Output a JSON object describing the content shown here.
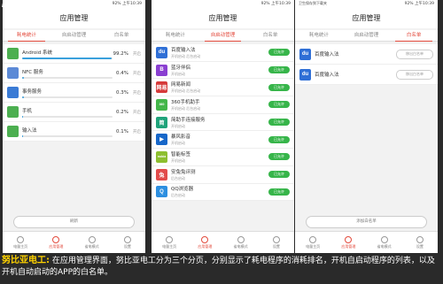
{
  "watermark": "IT之HOME",
  "status_bar": {
    "battery": "92%",
    "time": "上午10:39",
    "left_p3": "卫生保存到下载夹"
  },
  "header_title": "应用管理",
  "tabs": [
    "耗电统计",
    "自启动管理",
    "白名单"
  ],
  "screen1": {
    "active_tab": 0,
    "items": [
      {
        "name": "Android 系统",
        "percent": "99.2%",
        "fill": 0.99,
        "action": "开启",
        "icon": "android-system-icon",
        "color": "#4caf50"
      },
      {
        "name": "NFC 服务",
        "percent": "0.4%",
        "fill": 0.02,
        "action": "开启",
        "icon": "nfc-icon",
        "color": "#5c8ad6"
      },
      {
        "name": "事务服务",
        "percent": "0.3%",
        "fill": 0.015,
        "action": "开启",
        "icon": "service-icon",
        "color": "#3a7bd5"
      },
      {
        "name": "手机",
        "percent": "0.2%",
        "fill": 0.01,
        "action": "开启",
        "icon": "phone-icon",
        "color": "#4caf50"
      },
      {
        "name": "输入法",
        "percent": "0.1%",
        "fill": 0.005,
        "action": "开启",
        "icon": "keyboard-icon",
        "color": "#4caf50"
      }
    ],
    "bottom_button": "刷新"
  },
  "screen2": {
    "active_tab": 1,
    "items": [
      {
        "name": "百度输入法",
        "sub": "开机启动 后台启动",
        "button": "已允许",
        "icon": "baidu-input-icon",
        "color": "#2f6fd6",
        "glyph": "du"
      },
      {
        "name": "蓝牙伴侣",
        "sub": "开机启动",
        "button": "已允许",
        "icon": "bluetooth-icon",
        "color": "#8a3fd1",
        "glyph": "B"
      },
      {
        "name": "网易新闻",
        "sub": "开机启动 后台启动",
        "button": "已允许",
        "icon": "netease-icon",
        "color": "#d63a3a",
        "glyph": "网易"
      },
      {
        "name": "360手机助手",
        "sub": "开机启动 后台启动",
        "button": "已允许",
        "icon": "360-icon",
        "color": "#43b649",
        "glyph": "360"
      },
      {
        "name": "简助手连接服务",
        "sub": "开机启动",
        "button": "已允许",
        "icon": "jian-icon",
        "color": "#1fa37a",
        "glyph": "简"
      },
      {
        "name": "暴风影音",
        "sub": "开机启动",
        "button": "已允许",
        "icon": "storm-icon",
        "color": "#1767c9",
        "glyph": "▶"
      },
      {
        "name": "智能标签",
        "sub": "开机启动",
        "button": "已允许",
        "icon": "smart-tag-icon",
        "color": "#8dbf2f",
        "glyph": "nubia"
      },
      {
        "name": "安兔兔评测",
        "sub": "后台启动",
        "button": "已允许",
        "icon": "antutu-icon",
        "color": "#e24b4b",
        "glyph": "兔"
      },
      {
        "name": "QQ浏览器",
        "sub": "后台启动",
        "button": "已允许",
        "icon": "qq-browser-icon",
        "color": "#2d8fe0",
        "glyph": "Q"
      }
    ]
  },
  "screen3": {
    "active_tab": 2,
    "items": [
      {
        "name": "百度输入法",
        "button": "移出白名单",
        "icon": "baidu-input-icon",
        "color": "#2f6fd6",
        "glyph": "du"
      },
      {
        "name": "百度输入法",
        "button": "移出白名单",
        "icon": "baidu-input-icon",
        "color": "#2f6fd6",
        "glyph": "du"
      }
    ],
    "bottom_button": "添加白名单"
  },
  "bottom_nav": [
    "电量主页",
    "应用管理",
    "省电模式",
    "设置"
  ],
  "caption": {
    "highlight": "努比亚电工:",
    "text": "在应用管理界面，努比亚电工分为三个分页，分别显示了耗电程序的消耗排名，开机自启动程序的列表，以及开机自动启动的APP的白名单。"
  }
}
